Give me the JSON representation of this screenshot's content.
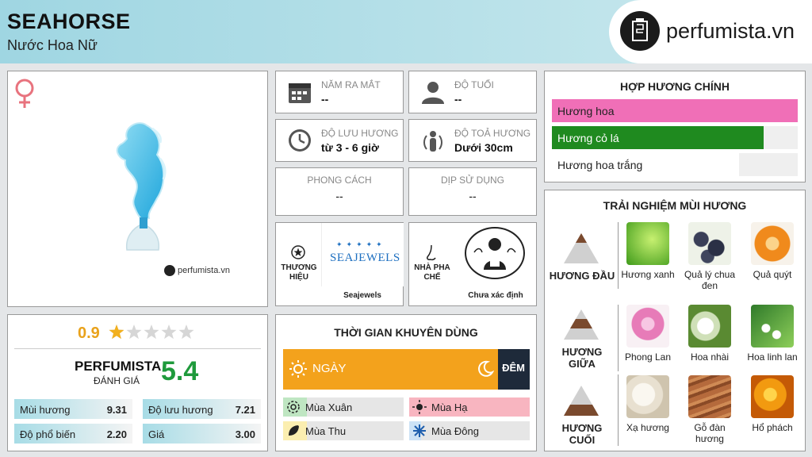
{
  "header": {
    "product_name": "SEAHORSE",
    "subtitle": "Nước Hoa Nữ",
    "brand_site": "perfumista.vn"
  },
  "image_card": {
    "gender_icon": "female-symbol-icon",
    "watermark": "perfumista.vn"
  },
  "info_tiles": {
    "release_year": {
      "label": "NĂM RA MẮT",
      "value": "--"
    },
    "age": {
      "label": "ĐỘ TUỔI",
      "value": "--"
    },
    "longevity": {
      "label": "ĐỘ LƯU HƯƠNG",
      "value": "từ 3 - 6 giờ"
    },
    "sillage": {
      "label": "ĐỘ TOẢ HƯƠNG",
      "value": "Dưới 30cm"
    },
    "style": {
      "label": "PHONG CÁCH",
      "value": "--"
    },
    "occasion": {
      "label": "DỊP SỬ DỤNG",
      "value": "--"
    }
  },
  "brand_tile": {
    "label_line1": "THƯƠNG",
    "label_line2": "HIỆU",
    "brand_logo_text": "SEAJEWELS",
    "brand_name": "Seajewels"
  },
  "perfumer_tile": {
    "label_line1": "NHÀ PHA",
    "label_line2": "CHẾ",
    "perfumer_name": "Chưa xác định"
  },
  "rating": {
    "user_score": "0.9",
    "stars": 0.9,
    "stars_max": 5,
    "perfumista_title": "PERFUMISTA",
    "perfumista_sub": "ĐÁNH GIÁ",
    "perfumista_score": "5.4",
    "stats": [
      {
        "label": "Mùi hương",
        "value": "9.31"
      },
      {
        "label": "Độ lưu hương",
        "value": "7.21"
      },
      {
        "label": "Độ phổ biến",
        "value": "2.20"
      },
      {
        "label": "Giá",
        "value": "3.00"
      }
    ]
  },
  "recommended_time": {
    "title": "THỜI GIAN KHUYÊN DÙNG",
    "day_label": "NGÀY",
    "night_label": "ĐÊM",
    "day_share": 0.87,
    "seasons": [
      {
        "label": "Mùa Xuân",
        "icon": "flower-icon",
        "color": "#bfe6c2",
        "level": 0.2
      },
      {
        "label": "Mùa Hạ",
        "icon": "sun-icon",
        "color": "#f8b5c0",
        "level": 1.0
      },
      {
        "label": "Mùa Thu",
        "icon": "leaf-icon",
        "color": "#fbeeb0",
        "level": 0.2
      },
      {
        "label": "Mùa Đông",
        "icon": "snowflake-icon",
        "color": "#cde3f6",
        "level": 0.1
      }
    ]
  },
  "main_accords": {
    "title": "HỢP HƯƠNG CHÍNH",
    "accords": [
      {
        "label": "Hương hoa",
        "level": 1.0,
        "color": "#f06fb7",
        "text_color": "#222222"
      },
      {
        "label": "Hương cỏ lá",
        "level": 0.86,
        "color": "#1f8a1f",
        "text_color": "#ffffff"
      },
      {
        "label": "Hương hoa trắng",
        "level": 0.76,
        "color": "#ffffff",
        "text_color": "#222222"
      }
    ]
  },
  "scent_experience": {
    "title": "TRẢI NGHIỆM MÙI HƯƠNG",
    "stages": [
      {
        "label": "HƯƠNG ĐẦU",
        "notes": [
          "Hương xanh",
          "Quả lý chua đen",
          "Quả quýt"
        ]
      },
      {
        "label": "HƯƠNG GIỮA",
        "notes": [
          "Phong Lan",
          "Hoa nhài",
          "Hoa linh lan"
        ]
      },
      {
        "label": "HƯƠNG CUỐI",
        "notes": [
          "Xạ hương",
          "Gỗ đàn hương",
          "Hổ phách"
        ]
      }
    ]
  }
}
